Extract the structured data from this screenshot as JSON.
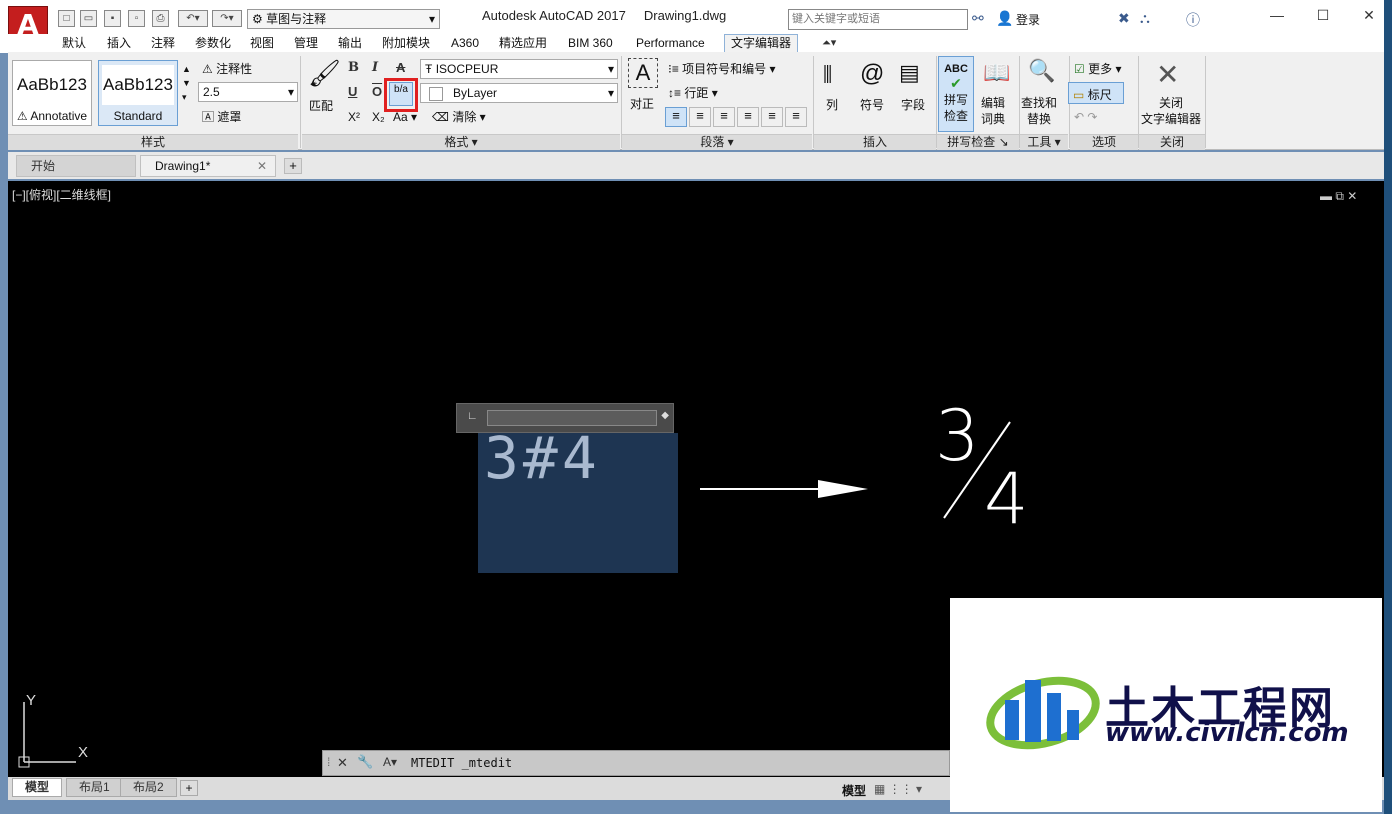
{
  "titlebar": {
    "workspace": "草图与注释",
    "app_title": "Autodesk AutoCAD 2017",
    "doc_title": "Drawing1.dwg",
    "search_placeholder": "键入关键字或短语",
    "login": "登录",
    "app_logo": "A"
  },
  "ribbon_tabs": [
    "默认",
    "插入",
    "注释",
    "参数化",
    "视图",
    "管理",
    "输出",
    "附加模块",
    "A360",
    "精选应用",
    "BIM 360",
    "Performance",
    "文字编辑器"
  ],
  "ribbon": {
    "styles": {
      "box1_sample": "AaBb123",
      "box1_name": "Annotative",
      "box2_sample": "AaBb123",
      "box2_name": "Standard",
      "annotative_label": "注释性",
      "height_value": "2.5",
      "mask_label": "遮罩",
      "panel_title": "样式"
    },
    "format": {
      "match_label": "匹配",
      "bold": "B",
      "italic": "I",
      "strike": "A",
      "underline": "U",
      "overline": "O",
      "stack": "b/a",
      "superscript": "X²",
      "subscript": "X₂",
      "case": "Aa",
      "font_value": "ISOCPEUR",
      "color_value": "ByLayer",
      "clear_label": "清除",
      "panel_title": "格式"
    },
    "paragraph": {
      "justify_label": "对正",
      "bullets_label": "项目符号和编号",
      "spacing_label": "行距",
      "panel_title": "段落"
    },
    "insert": {
      "columns_label": "列",
      "symbol_label": "符号",
      "field_label": "字段",
      "panel_title": "插入"
    },
    "spell": {
      "spellcheck_line1": "拼写",
      "spellcheck_line2": "检查",
      "dict_line1": "编辑",
      "dict_line2": "词典",
      "panel_title": "拼写检查"
    },
    "tools": {
      "find_line1": "查找和",
      "find_line2": "替换",
      "panel_title": "工具"
    },
    "options": {
      "more_label": "更多",
      "ruler_label": "标尺",
      "panel_title": "选项"
    },
    "close": {
      "close_line1": "关闭",
      "close_line2": "文字编辑器",
      "panel_title": "关闭"
    }
  },
  "doc_tabs": {
    "start": "开始",
    "drawing": "Drawing1*"
  },
  "viewport": {
    "label": "[−][俯视][二维线框]",
    "mtext": "3#4",
    "result_num": "3",
    "result_den": "4",
    "axis_y": "Y",
    "axis_x": "X"
  },
  "command": {
    "text": "MTEDIT _mtedit"
  },
  "layout_tabs": [
    "模型",
    "布局1",
    "布局2"
  ],
  "status": {
    "model": "模型"
  },
  "watermark": {
    "cn": "土木工程网",
    "en": "www.civilcn.com"
  }
}
